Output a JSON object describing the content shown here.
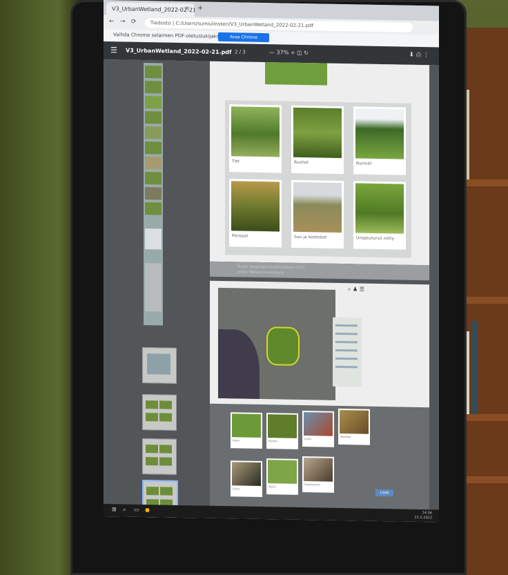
{
  "browser": {
    "tab_title": "V3_UrbanWetland_2022-02-21.pdf",
    "tab_close": "×",
    "tab_new": "+",
    "back": "←",
    "forward": "→",
    "reload": "⟳",
    "url": "Tiedosto | C:/Users/sumiulinsteri/V3_UrbanWetland_2022-02-21.pdf",
    "infobar_text": "Vaihda Chrome selaimen PDF-oletuslukijaksi",
    "infobar_button": "Avaa Chrome oletuslukijana"
  },
  "pdf": {
    "menu_icon": "☰",
    "title": "V3_UrbanWetland_2022-02-21.pdf",
    "page_indicator": "2 / 3",
    "zoom_out": "—",
    "zoom_level": "37%",
    "zoom_in": "+",
    "fit_icon": "◫",
    "rotate_icon": "↻",
    "download_icon": "⬇",
    "print_icon": "⎙",
    "more_icon": "⋮"
  },
  "page1": {
    "cards": [
      {
        "caption": "Tiet"
      },
      {
        "caption": "Ruohot"
      },
      {
        "caption": "Nurmet"
      },
      {
        "caption": "Pensaat"
      },
      {
        "caption": "Suo ja kosteikot"
      },
      {
        "caption": "Umpeutunut niitty"
      }
    ],
    "footer_line1": "Kuvat: Kaupungin ympäristötoimi 2022",
    "footer_line2": "Urban Wetland inventaario"
  },
  "page2": {
    "map_tools": "⌕ ♟ ☰",
    "species": [
      {
        "caption": "Kasvi"
      },
      {
        "caption": "Ruoho"
      },
      {
        "caption": "Lintu"
      },
      {
        "caption": "Nisäkäs"
      },
      {
        "caption": "Lintu"
      },
      {
        "caption": "Kasvi"
      },
      {
        "caption": "Hyönteinen"
      }
    ],
    "next_button": "Lisää"
  },
  "taskbar": {
    "start_icon": "⊞",
    "search_icon": "⌕",
    "taskview_icon": "▭",
    "tray_time": "14.56",
    "tray_date": "21.2.2022"
  }
}
